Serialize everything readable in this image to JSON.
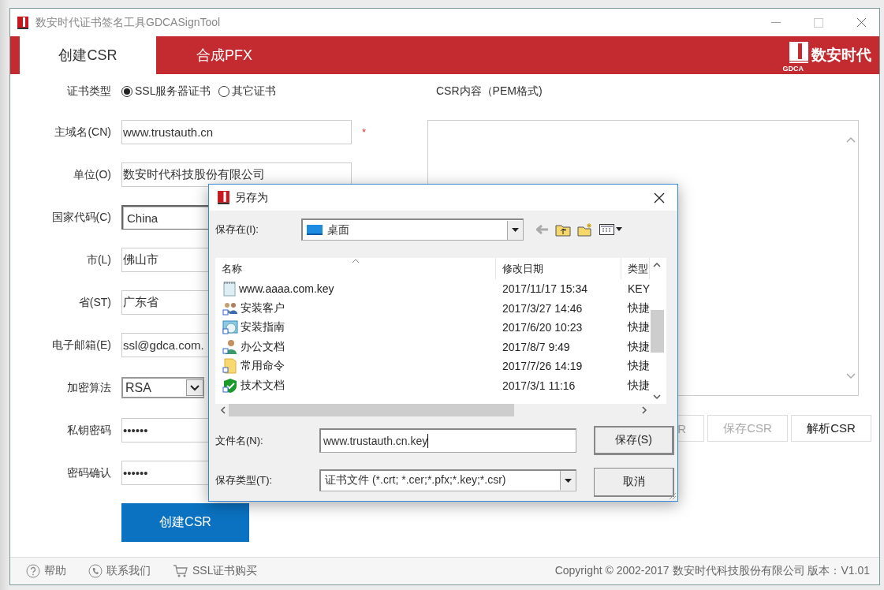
{
  "window": {
    "title": "数安时代证书签名工具GDCASignTool"
  },
  "tabs": [
    {
      "label": "创建CSR",
      "selected": true
    },
    {
      "label": "合成PFX",
      "selected": false
    }
  ],
  "brand": {
    "name": "数安时代",
    "sub": "GDCA"
  },
  "form": {
    "cert_type": {
      "label": "证书类型",
      "options": [
        {
          "label": "SSL服务器证书",
          "selected": true
        },
        {
          "label": "其它证书",
          "selected": false
        }
      ]
    },
    "fields": [
      {
        "kind": "text",
        "label": "主域名(CN)",
        "value": "www.trustauth.cn",
        "required_mark": "*",
        "focused": false
      },
      {
        "kind": "text",
        "label": "单位(O)",
        "value": "数安时代科技股份有限公司",
        "focused": false
      },
      {
        "kind": "text",
        "label": "国家代码(C)",
        "value": "China",
        "focused": true
      },
      {
        "kind": "text",
        "label": "市(L)",
        "value": "佛山市",
        "focused": false
      },
      {
        "kind": "text",
        "label": "省(ST)",
        "value": "广东省",
        "focused": false
      },
      {
        "kind": "text",
        "label": "电子邮箱(E)",
        "value": "ssl@gdca.com.",
        "focused": false
      },
      {
        "kind": "select",
        "label": "加密算法",
        "value": "RSA"
      },
      {
        "kind": "text",
        "label": "私钥密码",
        "value": "••••••",
        "focused": false
      },
      {
        "kind": "text",
        "label": "密码确认",
        "value": "••••••",
        "focused": false
      }
    ],
    "submit": "创建CSR"
  },
  "csr": {
    "label": "CSR内容（PEM格式)",
    "buttons": [
      {
        "label": "R",
        "disabled": true
      },
      {
        "label": "保存CSR",
        "disabled": true
      },
      {
        "label": "解析CSR",
        "disabled": false
      }
    ]
  },
  "footer": {
    "links": [
      "帮助",
      "联系我们",
      "SSL证书购买"
    ],
    "copyright": "Copyright © 2002-2017 数安时代科技股份有限公司 版本：V1.01"
  },
  "dialog": {
    "title": "另存为",
    "save_in": {
      "label": "保存在(I):",
      "value": "桌面"
    },
    "columns": [
      "名称",
      "修改日期",
      "类型"
    ],
    "files": [
      {
        "name": "www.aaaa.com.key",
        "modified": "2017/11/17 15:34",
        "type": "KEY"
      },
      {
        "name": "安装客户",
        "modified": "2017/3/27 14:46",
        "type": "快捷"
      },
      {
        "name": "安装指南",
        "modified": "2017/6/20 10:23",
        "type": "快捷"
      },
      {
        "name": "办公文档",
        "modified": "2017/8/7 9:49",
        "type": "快捷"
      },
      {
        "name": "常用命令",
        "modified": "2017/7/26 14:19",
        "type": "快捷"
      },
      {
        "name": "技术文档",
        "modified": "2017/3/1 11:16",
        "type": "快捷"
      }
    ],
    "file_name": {
      "label": "文件名(N):",
      "value": "www.trustauth.cn.key"
    },
    "file_type": {
      "label": "保存类型(T):",
      "value": "证书文件 (*.crt; *.cer;*.pfx;*.key;*.csr)"
    },
    "buttons": [
      {
        "label": "保存(S)",
        "default": true
      },
      {
        "label": "取消",
        "default": false
      }
    ]
  }
}
